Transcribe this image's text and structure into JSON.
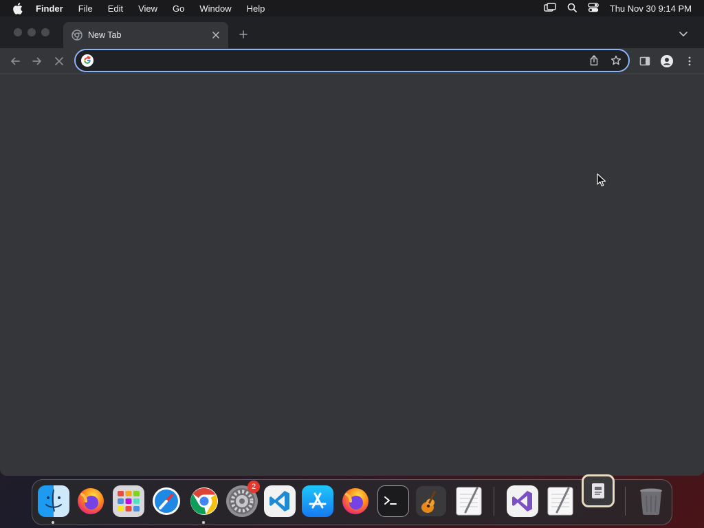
{
  "menubar": {
    "app_name": "Finder",
    "items": [
      "File",
      "Edit",
      "View",
      "Go",
      "Window",
      "Help"
    ],
    "clock": "Thu Nov 30  9:14 PM"
  },
  "browser": {
    "tab": {
      "title": "New Tab"
    },
    "omnibox": {
      "value": "",
      "placeholder": ""
    }
  },
  "dock": {
    "items": [
      {
        "name": "Finder",
        "icon": "finder-icon"
      },
      {
        "name": "Firefox",
        "icon": "firefox-icon"
      },
      {
        "name": "Launchpad",
        "icon": "launchpad-icon"
      },
      {
        "name": "Safari",
        "icon": "safari-icon"
      },
      {
        "name": "Google Chrome",
        "icon": "chrome-icon"
      },
      {
        "name": "System Settings",
        "icon": "system-settings-icon",
        "badge": "2"
      },
      {
        "name": "Visual Studio Code",
        "icon": "vscode-icon"
      },
      {
        "name": "App Store",
        "icon": "app-store-icon"
      },
      {
        "name": "Firefox",
        "icon": "firefox-icon"
      },
      {
        "name": "Terminal",
        "icon": "terminal-icon"
      },
      {
        "name": "GarageBand",
        "icon": "garageband-icon"
      },
      {
        "name": "TextEdit",
        "icon": "textedit-icon"
      },
      {
        "name": "Visual Studio",
        "icon": "visual-studio-icon"
      },
      {
        "name": "TextEdit",
        "icon": "textedit-icon"
      },
      {
        "name": "Preview",
        "icon": "preview-icon"
      },
      {
        "name": "Trash",
        "icon": "trash-icon"
      }
    ]
  },
  "colors": {
    "accent": "#8ab4f8",
    "window_bg": "#35363a",
    "tabstrip_bg": "#202124",
    "badge": "#e5372d"
  }
}
